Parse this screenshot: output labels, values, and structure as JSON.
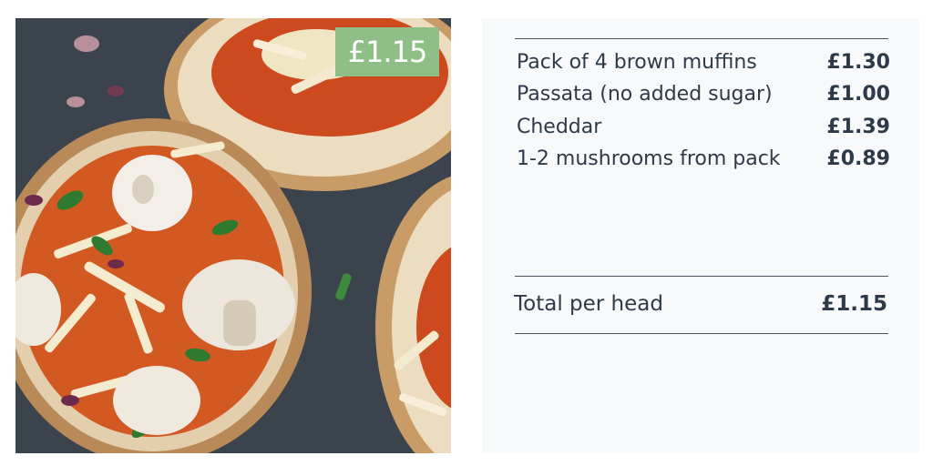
{
  "photo": {
    "price_badge": "£1.15",
    "badge_color": "#8fbf87"
  },
  "cost_breakdown": {
    "items": [
      {
        "label": "Pack of 4 brown muffins",
        "price": "£1.30"
      },
      {
        "label": "Passata (no added sugar)",
        "price": "£1.00"
      },
      {
        "label": "Cheddar",
        "price": "£1.39"
      },
      {
        "label": "1-2 mushrooms from pack",
        "price": "£0.89"
      }
    ],
    "total_label": "Total per head",
    "total_price": "£1.15",
    "text_color": "#2e3a4a"
  }
}
